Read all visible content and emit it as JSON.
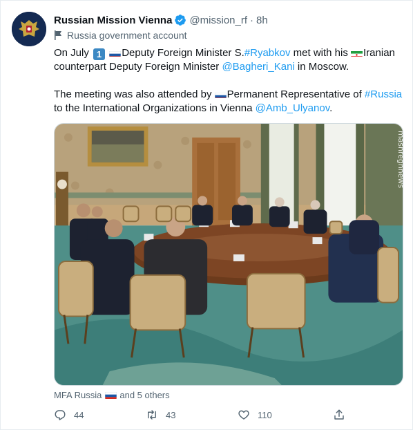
{
  "author": {
    "name": "Russian Mission Vienna",
    "handle": "@mission_rf",
    "separator": "·",
    "time": "8h",
    "label": "Russia government account"
  },
  "tweet": {
    "p1_a": "On July",
    "p1_keycap": "1",
    "p1_b": "Deputy Foreign Minister S.",
    "p1_mention1": "#Ryabkov",
    "p1_c": " met with his ",
    "p1_d": "Iranian",
    "p1_e": "counterpart Deputy Foreign Minister ",
    "p1_mention2": "@Bagheri_Kani",
    "p1_f": " in Moscow.",
    "p2_a": "The meeting was also attended by ",
    "p2_b": "Permanent Representative of ",
    "p2_hashtag": "#Russia",
    "p2_c": "to the International Organizations in Vienna ",
    "p2_mention": "@Amb_Ulyanov",
    "p2_d": "."
  },
  "media": {
    "tagged_a": "MFA Russia",
    "tagged_b": "and 5 others",
    "watermark": "mashreghnews"
  },
  "actions": {
    "replies": "44",
    "retweets": "43",
    "likes": "110"
  },
  "colors": {
    "link": "#1d9bf0",
    "secondary_text": "#536471",
    "verified": "#1d9bf0"
  },
  "icons": [
    "emblem-icon",
    "verified-icon",
    "government-flag-icon",
    "reply-icon",
    "retweet-icon",
    "like-icon",
    "share-icon"
  ]
}
